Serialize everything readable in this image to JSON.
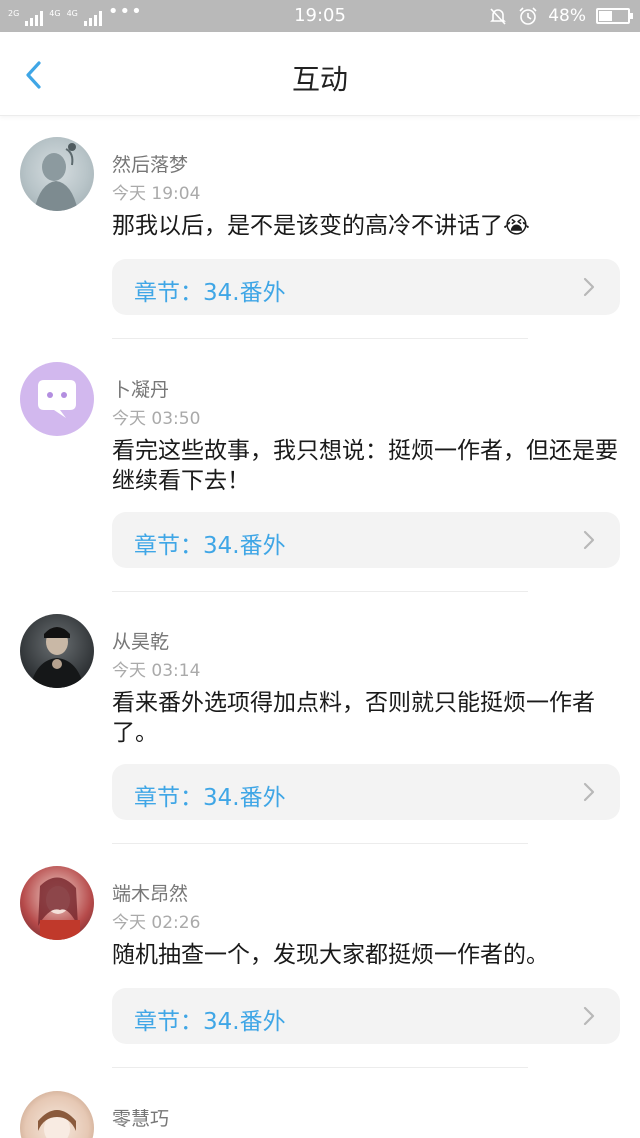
{
  "status_bar": {
    "network_labels": [
      "2G",
      "4G",
      "4G"
    ],
    "more": "•••",
    "time": "19:05",
    "battery_percent": "48%",
    "battery_level": 0.48
  },
  "header": {
    "title": "互动"
  },
  "comments": [
    {
      "name": "然后落梦",
      "time": "今天 19:04",
      "text": "那我以后，是不是该变的高冷不讲话了😭",
      "chapter": "章节：34.番外"
    },
    {
      "name": "卜凝丹",
      "time": "今天 03:50",
      "text": "看完这些故事，我只想说：挺烦一作者，但还是要继续看下去！",
      "chapter": "章节：34.番外"
    },
    {
      "name": "从昊乾",
      "time": "今天 03:14",
      "text": "看来番外选项得加点料，否则就只能挺烦一作者了。",
      "chapter": "章节：34.番外"
    },
    {
      "name": "端木昂然",
      "time": "今天 02:26",
      "text": "随机抽查一个，发现大家都挺烦一作者的。",
      "chapter": "章节：34.番外"
    },
    {
      "name": "零慧巧",
      "time": "",
      "text": "",
      "chapter": ""
    }
  ],
  "colors": {
    "accent": "#3fa6e6",
    "status_bar": "#b9b9b9"
  }
}
